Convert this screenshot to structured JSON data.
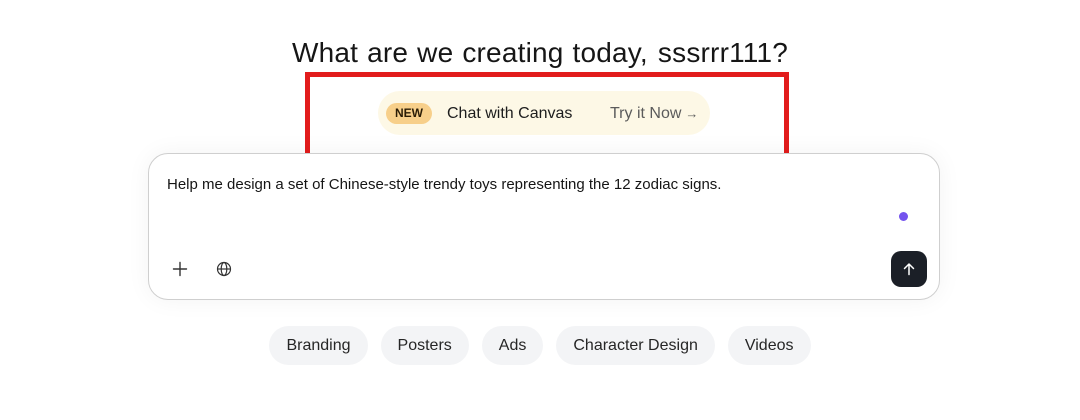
{
  "headline": {
    "text": "What are we creating today,",
    "username": "sssrrr111?"
  },
  "promo": {
    "badge": "NEW",
    "title": "Chat with Canvas",
    "cta": "Try it Now",
    "cta_arrow": "→"
  },
  "composer": {
    "prompt": "Help me design a set of Chinese-style trendy toys representing the 12 zodiac signs.",
    "add_icon": "plus-icon",
    "web_icon": "globe-icon",
    "send_icon": "arrow-up-icon",
    "status_dot_color": "#7453ee"
  },
  "chips": [
    {
      "label": "Branding"
    },
    {
      "label": "Posters"
    },
    {
      "label": "Ads"
    },
    {
      "label": "Character Design"
    },
    {
      "label": "Videos"
    }
  ],
  "colors": {
    "highlight_border": "#e21c1c",
    "badge_bg": "#f7cf8a",
    "promo_bg": "#fdf8e6",
    "send_bg": "#1b1f27",
    "chip_bg": "#f3f4f6"
  }
}
